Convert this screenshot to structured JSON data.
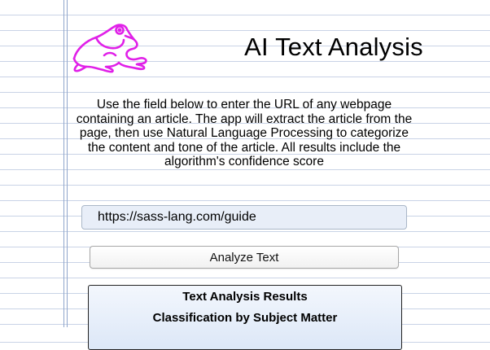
{
  "header": {
    "title": "AI Text Analysis",
    "logo_icon": "frog-icon",
    "logo_color": "#e020e8"
  },
  "intro": {
    "text": "Use the field below to enter the URL of any webpage containing an article. The app will extract the article from the page, then use Natural Language Processing to categorize the content and tone of the article. All results include the algorithm's confidence score"
  },
  "url_field": {
    "value": "https://sass-lang.com/guide",
    "placeholder": ""
  },
  "analyze_button": {
    "label": "Analyze Text"
  },
  "results": {
    "title": "Text Analysis Results",
    "subtitle": "Classification by Subject Matter"
  },
  "colors": {
    "paper_rule": "#c9d3e6",
    "margin_rule": "#8fa6cc",
    "input_background": "#e8eef8"
  }
}
